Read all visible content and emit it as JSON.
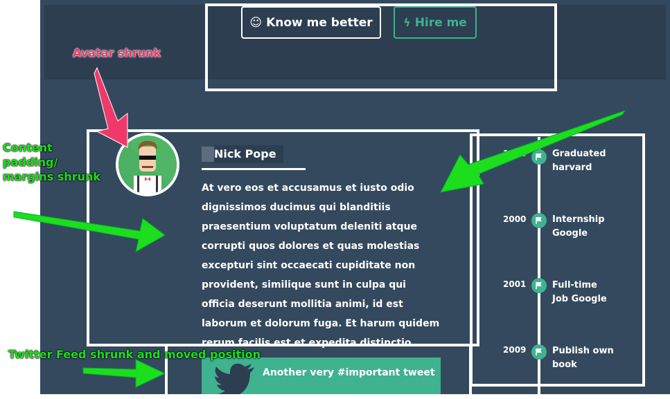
{
  "header": {
    "know_label": "Know me better",
    "hire_label": "Hire me"
  },
  "profile": {
    "name": "Nick Pope",
    "bio": "At vero eos et accusamus et iusto odio dignissimos ducimus qui blanditiis praesentium voluptatum deleniti atque corrupti quos dolores et quas molestias excepturi sint occaecati cupiditate non provident, similique sunt in culpa qui officia deserunt mollitia animi, id est laborum et dolorum fuga. Et harum quidem rerum facilis est et expedita distinctio."
  },
  "timeline": {
    "items": [
      {
        "year": "1998",
        "text_line1": "Graduated",
        "text_line2": "harvard"
      },
      {
        "year": "2000",
        "text_line1": "Internship",
        "text_line2": "Google"
      },
      {
        "year": "2001",
        "text_line1": "Full-time",
        "text_line2": "Job Google"
      },
      {
        "year": "2009",
        "text_line1": "Publish own",
        "text_line2": "book"
      }
    ]
  },
  "tweet": {
    "text": "Another very #important tweet"
  },
  "annotations": {
    "avatar": "Avatar shrunk",
    "content_l1": "Content",
    "content_l2": "padding/",
    "content_l3": "margins shrunk",
    "twitter": "Twitter Feed shrunk and moved position"
  },
  "colors": {
    "background": "#34495e",
    "header": "#2c3e50",
    "accent": "#3fb28f",
    "annotation_pink": "#f0396b",
    "annotation_green": "#1dde1d"
  }
}
